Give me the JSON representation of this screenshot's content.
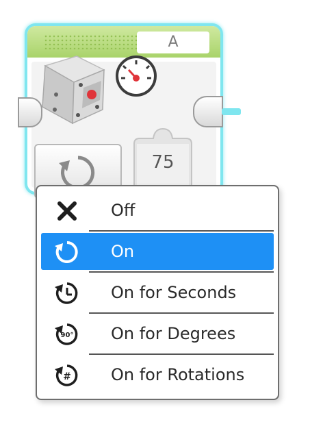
{
  "block": {
    "port_label": "A",
    "power_value": "75",
    "colors": {
      "outline": "#7fe6ef",
      "header": "#a9d36a",
      "motor_accent": "#e0343a"
    }
  },
  "mode_menu": {
    "selected_index": 1,
    "highlight_color": "#1e90f5",
    "items": [
      {
        "label": "Off",
        "icon": "off-x-icon"
      },
      {
        "label": "On",
        "icon": "rotate-on-icon"
      },
      {
        "label": "On for Seconds",
        "icon": "rotate-seconds-icon"
      },
      {
        "label": "On for Degrees",
        "icon": "rotate-degrees-icon",
        "icon_text": "90°"
      },
      {
        "label": "On for Rotations",
        "icon": "rotate-rotations-icon",
        "icon_text": "#"
      }
    ]
  }
}
